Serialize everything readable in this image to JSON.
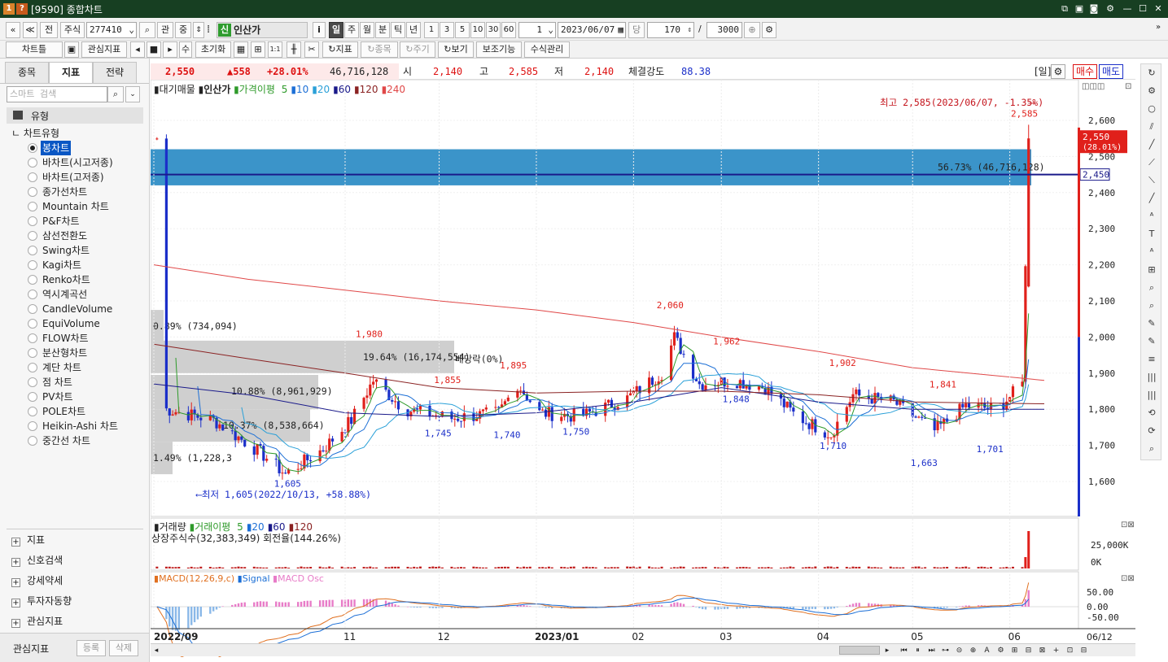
{
  "window": {
    "title": "[9590] 종합차트",
    "badge1": "1",
    "badge2": "?"
  },
  "toolbar1": {
    "nav_first": "«",
    "nav_up": "≪",
    "prev": "전",
    "market": "주식",
    "code": "277410",
    "search_icon": "⌕",
    "gwan": "관",
    "sang": "중",
    "stock_badge": "신",
    "stock_name": "인산가",
    "info": "i",
    "periods": [
      "일",
      "주",
      "월",
      "분",
      "틱",
      "년"
    ],
    "active_period": "일",
    "intervals": [
      "1",
      "3",
      "5",
      "10",
      "30",
      "60"
    ],
    "count": "1",
    "date": "2023/06/07",
    "dang": "당",
    "bars": "170",
    "slash": "/",
    "max_bars": "3000"
  },
  "toolbar2": {
    "chart_type": "차트틀",
    "watch": "관심지표",
    "su": "수",
    "reset": "초기화",
    "add_indicator": "지표",
    "add_stock": "종목",
    "period_btn": "주기",
    "view": "보기",
    "aux": "보조기능",
    "formula": "수식관리"
  },
  "sidebar": {
    "tabs": [
      "종목",
      "지표",
      "전략"
    ],
    "active_tab": "지표",
    "search_placeholder": "스마트 검색",
    "section_title": "유형",
    "tree_root": "차트유형",
    "chart_types": [
      "봉차트",
      "바차트(시고저종)",
      "바차트(고저종)",
      "종가선차트",
      "Mountain 차트",
      "P&F차트",
      "삼선전환도",
      "Swing차트",
      "Kagi차트",
      "Renko차트",
      "역시계곡선",
      "CandleVolume",
      "EquiVolume",
      "FLOW차트",
      "분산형차트",
      "계단 차트",
      "점 차트",
      "PV차트",
      "POLE차트",
      "Heikin-Ashi 차트",
      "중간선 차트"
    ],
    "selected": "봉차트",
    "bottom_sections": [
      "지표",
      "신호검색",
      "강세약세",
      "투자자동향",
      "관심지표"
    ],
    "footer_label": "관심지표",
    "register": "등록",
    "delete": "삭제"
  },
  "quote": {
    "price": "2,550",
    "change": "▲558",
    "pct": "+28.01%",
    "volume": "46,716,128",
    "open_label": "시",
    "open": "2,140",
    "high_label": "고",
    "high": "2,585",
    "low_label": "저",
    "low": "2,140",
    "strength_label": "체결강도",
    "strength": "88.38",
    "period_label": "[일]",
    "buy": "매수",
    "sell": "매도"
  },
  "price_legend": {
    "profile": "대기매물",
    "stock": "인산가",
    "ma_label": "가격이평",
    "ma": [
      "5",
      "10",
      "20",
      "60",
      "120",
      "240"
    ]
  },
  "vol_legend": {
    "title": "거래량",
    "ma_label": "거래이평",
    "ma": [
      "5",
      "20",
      "60",
      "120"
    ],
    "info": "상장주식수(32,383,349) 회전율(144.26%)"
  },
  "macd_legend": {
    "title": "MACD(12,26,9,c)",
    "signal": "Signal",
    "osc": "MACD Osc"
  },
  "annotations": {
    "high_note": "최고 2,585(2023/06/07, -1.35%)",
    "low_note": "최저 1,605(2022/10/13, +58.88%)",
    "dividend": "배당락(0%)",
    "profile_labels": [
      "56.73% (46,716,128)",
      "0.89% (734,094)",
      "19.64% (16,174,554)",
      "10.88% (8,961,929)",
      "10.37% (8,538,664)",
      "1.49% (1,228,3"
    ],
    "price_tags": [
      "2,585",
      "2,060",
      "1,980",
      "1,962",
      "1,902",
      "1,895",
      "1,855",
      "1,848",
      "1,841",
      "1,745",
      "1,740",
      "1,750",
      "1,710",
      "1,663",
      "1,701",
      "1,605"
    ],
    "current_tag": "2,550",
    "current_pct": "(28.01%)",
    "line_tag": "2,450"
  },
  "chart_data": {
    "type": "candlestick",
    "price_axis": [
      "2,600",
      "2,500",
      "2,400",
      "2,300",
      "2,200",
      "2,100",
      "2,000",
      "1,900",
      "1,800",
      "1,700",
      "1,600"
    ],
    "volume_axis": [
      "25,000K",
      "0K"
    ],
    "macd_axis": [
      "50.00",
      "0.00",
      "-50.00"
    ],
    "x_labels": [
      "2022/09",
      "11",
      "12",
      "2023/01",
      "02",
      "03",
      "04",
      "05",
      "06",
      "06/12"
    ],
    "ylim": [
      1550,
      2680
    ],
    "colors": {
      "up": "#e0201b",
      "down": "#1b2fc9",
      "ma5": "#2e9a2a",
      "ma10": "#1c6fd6",
      "ma20": "#2aa0d8",
      "ma60": "#1a1a8a",
      "ma120": "#8a2222",
      "ma240": "#e04848"
    },
    "anchors": [
      [
        "2022/09/05",
        1800
      ],
      [
        "2022/09/20",
        1770
      ],
      [
        "2022/10/05",
        1680
      ],
      [
        "2022/10/13",
        1620
      ],
      [
        "2022/10/25",
        1690
      ],
      [
        "2022/11/03",
        1770
      ],
      [
        "2022/11/10",
        1880
      ],
      [
        "2022/11/20",
        1800
      ],
      [
        "2022/12/05",
        1775
      ],
      [
        "2022/12/20",
        1790
      ],
      [
        "2022/12/26",
        1870
      ],
      [
        "2023/01/02",
        1790
      ],
      [
        "2023/01/15",
        1780
      ],
      [
        "2023/01/30",
        1830
      ],
      [
        "2023/02/10",
        1900
      ],
      [
        "2023/02/14",
        2000
      ],
      [
        "2023/02/22",
        1870
      ],
      [
        "2023/03/05",
        1880
      ],
      [
        "2023/03/15",
        1860
      ],
      [
        "2023/03/25",
        1780
      ],
      [
        "2023/04/05",
        1730
      ],
      [
        "2023/04/12",
        1840
      ],
      [
        "2023/04/25",
        1820
      ],
      [
        "2023/05/08",
        1740
      ],
      [
        "2023/05/18",
        1810
      ],
      [
        "2023/05/28",
        1800
      ],
      [
        "2023/06/05",
        1870
      ],
      [
        "2023/06/07",
        2550
      ],
      [
        "2023/06/12",
        2550
      ]
    ],
    "ma120_curve": [
      [
        "2022/09/01",
        1980
      ],
      [
        "2022/10/01",
        1940
      ],
      [
        "2022/11/01",
        1900
      ],
      [
        "2022/12/01",
        1860
      ],
      [
        "2023/01/01",
        1845
      ],
      [
        "2023/02/01",
        1850
      ],
      [
        "2023/03/01",
        1850
      ],
      [
        "2023/04/01",
        1840
      ],
      [
        "2023/05/01",
        1820
      ],
      [
        "2023/06/12",
        1815
      ]
    ],
    "ma240_curve": [
      [
        "2022/09/01",
        2200
      ],
      [
        "2022/10/01",
        2160
      ],
      [
        "2022/11/01",
        2130
      ],
      [
        "2022/12/01",
        2100
      ],
      [
        "2023/01/01",
        2075
      ],
      [
        "2023/02/01",
        2040
      ],
      [
        "2023/03/01",
        2000
      ],
      [
        "2023/04/01",
        1960
      ],
      [
        "2023/05/01",
        1915
      ],
      [
        "2023/06/12",
        1880
      ]
    ],
    "ma60_curve": [
      [
        "2022/09/01",
        1870
      ],
      [
        "2022/10/01",
        1840
      ],
      [
        "2022/11/01",
        1790
      ],
      [
        "2022/12/01",
        1780
      ],
      [
        "2023/01/01",
        1790
      ],
      [
        "2023/02/01",
        1820
      ],
      [
        "2023/03/01",
        1860
      ],
      [
        "2023/04/01",
        1820
      ],
      [
        "2023/05/01",
        1800
      ],
      [
        "2023/06/12",
        1800
      ]
    ]
  }
}
